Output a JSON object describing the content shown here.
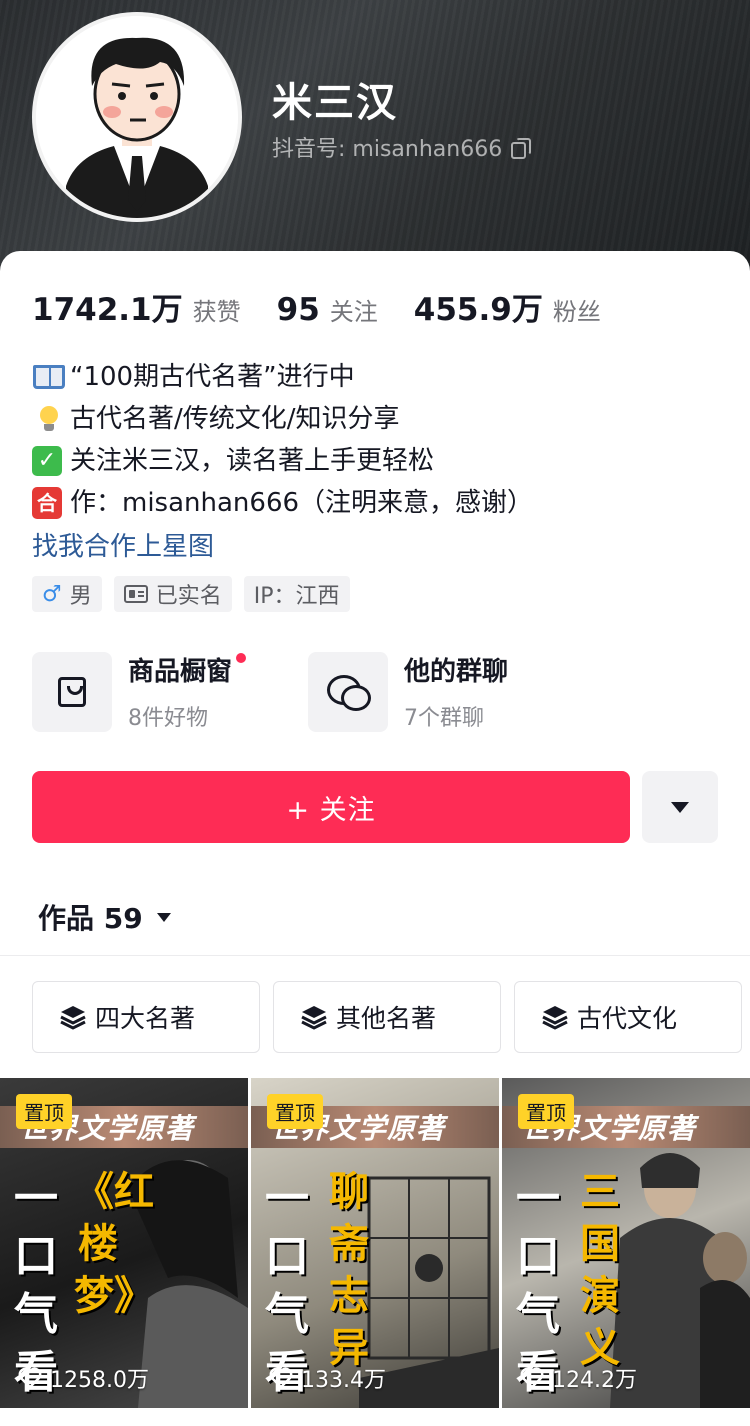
{
  "profile": {
    "name": "米三汉",
    "douyin_id": "抖音号: misanhan666"
  },
  "stats": [
    {
      "value": "1742.1万",
      "label": "获赞"
    },
    {
      "value": "95",
      "label": "关注"
    },
    {
      "value": "455.9万",
      "label": "粉丝"
    }
  ],
  "bio": {
    "lines": [
      {
        "icon": "book-icon",
        "text": "“100期古代名著”进行中"
      },
      {
        "icon": "lightbulb-icon",
        "text": "古代名著/传统文化/知识分享"
      },
      {
        "icon": "check-mark-icon",
        "text": "关注米三汉，读名著上手更轻松"
      },
      {
        "icon": "he-emoji-icon",
        "glyph": "合",
        "text": "作：misanhan666（注明来意，感谢）"
      }
    ],
    "link": "找我合作上星图"
  },
  "tags": [
    {
      "icon": "male-icon",
      "text": "男"
    },
    {
      "icon": "id-card-icon",
      "text": "已实名"
    },
    {
      "icon": "",
      "text": "IP：江西"
    }
  ],
  "features": [
    {
      "icon": "shopping-bag-icon",
      "title": "商品橱窗",
      "subtitle": "8件好物",
      "has_dot": true
    },
    {
      "icon": "group-chat-icon",
      "title": "他的群聊",
      "subtitle": "7个群聊",
      "has_dot": false
    }
  ],
  "actions": {
    "follow_label": "+ 关注"
  },
  "works": {
    "label": "作品 59"
  },
  "collections": [
    {
      "icon": "layers-icon",
      "label": "四大名著"
    },
    {
      "icon": "layers-icon",
      "label": "其他名著"
    },
    {
      "icon": "layers-icon",
      "label": "古代文化"
    }
  ],
  "videos": [
    {
      "pinned": "置顶",
      "banner": "世界文学原著",
      "left_text": "一口气看",
      "right_text": "《红楼梦》",
      "likes": "1258.0万"
    },
    {
      "pinned": "置顶",
      "banner": "世界文学原著",
      "left_text": "一口气看",
      "right_text": "聊斋志异",
      "likes": "133.4万"
    },
    {
      "pinned": "置顶",
      "banner": "世界文学原著",
      "left_text": "一口气看",
      "right_text": "三国演义",
      "likes": "124.2万"
    }
  ],
  "colors": {
    "accent": "#fe2c55",
    "link": "#2d5a96",
    "pin": "#ffd228",
    "title_yellow": "#f5b800"
  }
}
